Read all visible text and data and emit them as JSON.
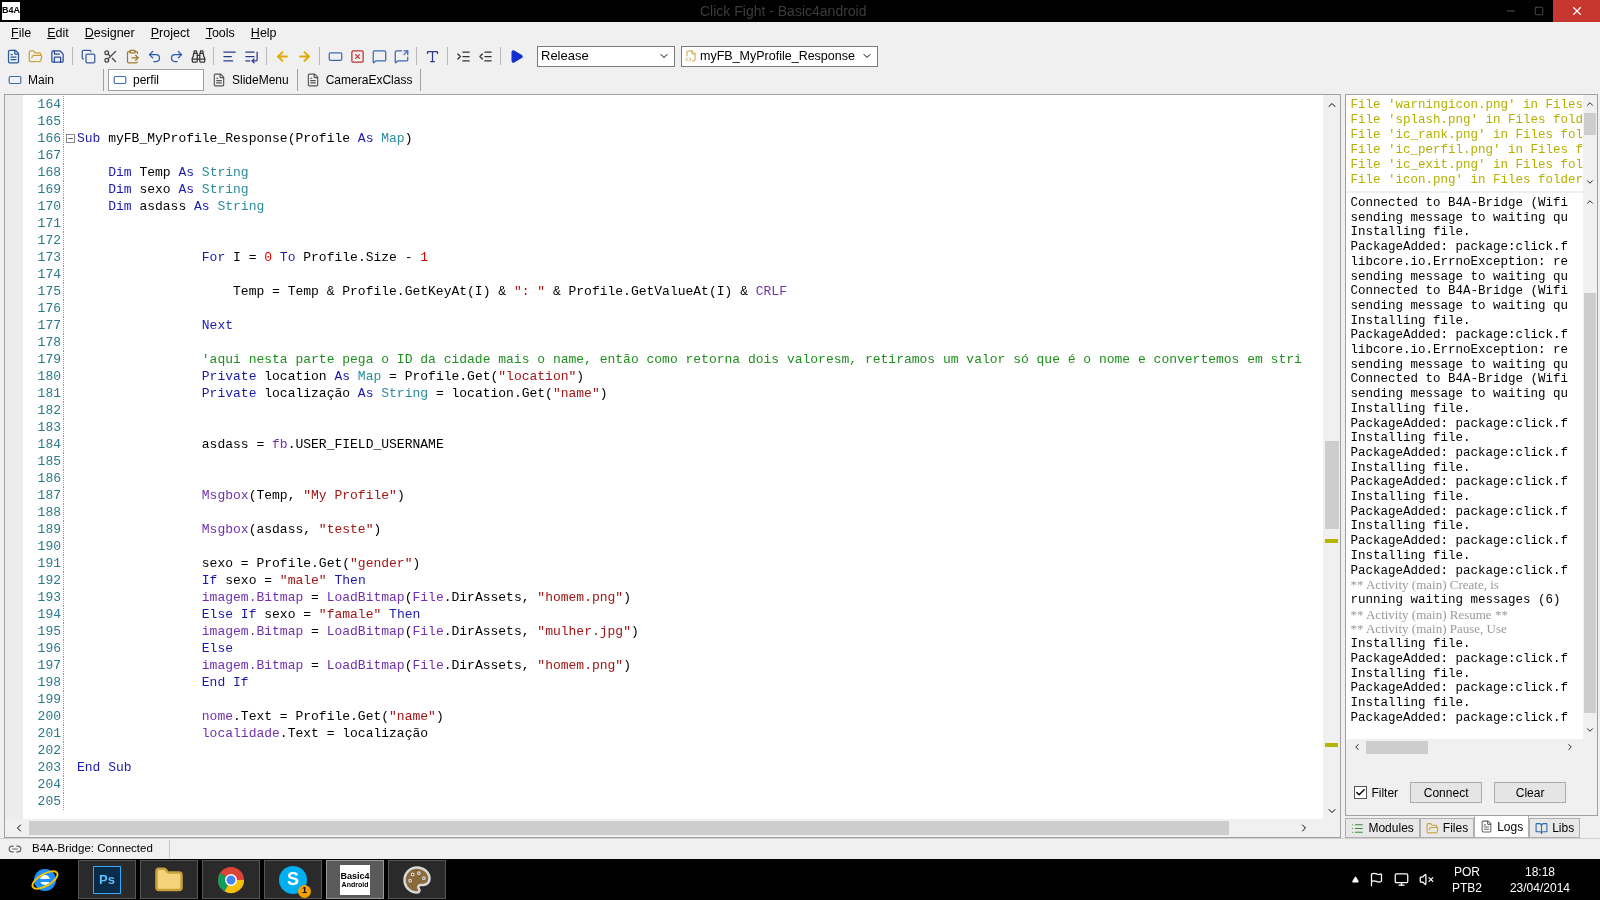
{
  "window": {
    "logo": "B4A",
    "title": "Click Fight - Basic4android"
  },
  "menu": [
    "File",
    "Edit",
    "Designer",
    "Project",
    "Tools",
    "Help"
  ],
  "toolbar": {
    "build_config": "Release",
    "sub_selector": "myFB_MyProfile_Response"
  },
  "module_tabs": [
    {
      "label": "Main",
      "selected": false
    },
    {
      "label": "perfil",
      "selected": true
    },
    {
      "label": "SlideMenu",
      "selected": false
    },
    {
      "label": "CameraExClass",
      "selected": false
    }
  ],
  "editor": {
    "lines": [
      {
        "number": "164"
      },
      {
        "number": "165"
      },
      {
        "number": "166",
        "fold": true,
        "tokens": [
          {
            "kind": "kw",
            "text": "Sub"
          },
          {
            "kind": "plain",
            "text": " myFB_MyProfile_Response(Profile "
          },
          {
            "kind": "kw",
            "text": "As"
          },
          {
            "kind": "type",
            "text": " Map"
          },
          {
            "kind": "plain",
            "text": ")"
          }
        ]
      },
      {
        "number": "167"
      },
      {
        "number": "168",
        "tokens": [
          {
            "kind": "kw",
            "text": "    Dim"
          },
          {
            "kind": "plain",
            "text": " Temp "
          },
          {
            "kind": "kw",
            "text": "As"
          },
          {
            "kind": "type",
            "text": " String"
          }
        ]
      },
      {
        "number": "169",
        "tokens": [
          {
            "kind": "kw",
            "text": "    Dim"
          },
          {
            "kind": "plain",
            "text": " sexo "
          },
          {
            "kind": "kw",
            "text": "As"
          },
          {
            "kind": "type",
            "text": " String"
          }
        ]
      },
      {
        "number": "170",
        "tokens": [
          {
            "kind": "kw",
            "text": "    Dim"
          },
          {
            "kind": "plain",
            "text": " asdass "
          },
          {
            "kind": "kw",
            "text": "As"
          },
          {
            "kind": "type",
            "text": " String"
          }
        ]
      },
      {
        "number": "171"
      },
      {
        "number": "172"
      },
      {
        "number": "173",
        "tokens": [
          {
            "kind": "kw",
            "text": "                For"
          },
          {
            "kind": "plain",
            "text": " I = "
          },
          {
            "kind": "num",
            "text": "0"
          },
          {
            "kind": "kw",
            "text": " To"
          },
          {
            "kind": "plain",
            "text": " Profile.Size - "
          },
          {
            "kind": "num",
            "text": "1"
          }
        ]
      },
      {
        "number": "174"
      },
      {
        "number": "175",
        "tokens": [
          {
            "kind": "plain",
            "text": "                    Temp = Temp & Profile.GetKeyAt(I) & "
          },
          {
            "kind": "str",
            "text": "\": \""
          },
          {
            "kind": "plain",
            "text": " & Profile.GetValueAt(I) & "
          },
          {
            "kind": "obj",
            "text": "CRLF"
          }
        ]
      },
      {
        "number": "176"
      },
      {
        "number": "177",
        "tokens": [
          {
            "kind": "kw",
            "text": "                Next"
          }
        ]
      },
      {
        "number": "178"
      },
      {
        "number": "179",
        "tokens": [
          {
            "kind": "cmt",
            "text": "                'aqui nesta parte pega o ID da cidade mais o name, então como retorna dois valoresm, retiramos um valor só que é o nome e convertemos em stri"
          }
        ]
      },
      {
        "number": "180",
        "tokens": [
          {
            "kind": "kw",
            "text": "                Private"
          },
          {
            "kind": "plain",
            "text": " location "
          },
          {
            "kind": "kw",
            "text": "As"
          },
          {
            "kind": "type",
            "text": " Map"
          },
          {
            "kind": "plain",
            "text": " = Profile.Get("
          },
          {
            "kind": "str",
            "text": "\"location\""
          },
          {
            "kind": "plain",
            "text": ")"
          }
        ]
      },
      {
        "number": "181",
        "tokens": [
          {
            "kind": "kw",
            "text": "                Private"
          },
          {
            "kind": "plain",
            "text": " localização "
          },
          {
            "kind": "kw",
            "text": "As"
          },
          {
            "kind": "type",
            "text": " String"
          },
          {
            "kind": "plain",
            "text": " = location.Get("
          },
          {
            "kind": "str",
            "text": "\"name\""
          },
          {
            "kind": "plain",
            "text": ")"
          }
        ]
      },
      {
        "number": "182"
      },
      {
        "number": "183"
      },
      {
        "number": "184",
        "tokens": [
          {
            "kind": "plain",
            "text": "                asdass = "
          },
          {
            "kind": "obj",
            "text": "fb"
          },
          {
            "kind": "plain",
            "text": ".USER_FIELD_USERNAME"
          }
        ]
      },
      {
        "number": "185"
      },
      {
        "number": "186"
      },
      {
        "number": "187",
        "tokens": [
          {
            "kind": "obj",
            "text": "                Msgbox"
          },
          {
            "kind": "plain",
            "text": "(Temp, "
          },
          {
            "kind": "str",
            "text": "\"My Profile\""
          },
          {
            "kind": "plain",
            "text": ")"
          }
        ]
      },
      {
        "number": "188"
      },
      {
        "number": "189",
        "tokens": [
          {
            "kind": "obj",
            "text": "                Msgbox"
          },
          {
            "kind": "plain",
            "text": "(asdass, "
          },
          {
            "kind": "str",
            "text": "\"teste\""
          },
          {
            "kind": "plain",
            "text": ")"
          }
        ]
      },
      {
        "number": "190"
      },
      {
        "number": "191",
        "tokens": [
          {
            "kind": "plain",
            "text": "                sexo = Profile.Get("
          },
          {
            "kind": "str",
            "text": "\"gender\""
          },
          {
            "kind": "plain",
            "text": ")"
          }
        ]
      },
      {
        "number": "192",
        "tokens": [
          {
            "kind": "kw",
            "text": "                If"
          },
          {
            "kind": "plain",
            "text": " sexo = "
          },
          {
            "kind": "str",
            "text": "\"male\""
          },
          {
            "kind": "kw",
            "text": " Then"
          }
        ]
      },
      {
        "number": "193",
        "tokens": [
          {
            "kind": "obj",
            "text": "                imagem.Bitmap"
          },
          {
            "kind": "plain",
            "text": " = "
          },
          {
            "kind": "obj",
            "text": "LoadBitmap"
          },
          {
            "kind": "plain",
            "text": "("
          },
          {
            "kind": "obj",
            "text": "File"
          },
          {
            "kind": "plain",
            "text": ".DirAssets, "
          },
          {
            "kind": "str",
            "text": "\"homem.png\""
          },
          {
            "kind": "plain",
            "text": ")"
          }
        ]
      },
      {
        "number": "194",
        "tokens": [
          {
            "kind": "kw",
            "text": "                Else If"
          },
          {
            "kind": "plain",
            "text": " sexo = "
          },
          {
            "kind": "str",
            "text": "\"famale\""
          },
          {
            "kind": "kw",
            "text": " Then"
          }
        ]
      },
      {
        "number": "195",
        "tokens": [
          {
            "kind": "obj",
            "text": "                imagem.Bitmap"
          },
          {
            "kind": "plain",
            "text": " = "
          },
          {
            "kind": "obj",
            "text": "LoadBitmap"
          },
          {
            "kind": "plain",
            "text": "("
          },
          {
            "kind": "obj",
            "text": "File"
          },
          {
            "kind": "plain",
            "text": ".DirAssets, "
          },
          {
            "kind": "str",
            "text": "\"mulher.jpg\""
          },
          {
            "kind": "plain",
            "text": ")"
          }
        ]
      },
      {
        "number": "196",
        "tokens": [
          {
            "kind": "kw",
            "text": "                Else"
          }
        ]
      },
      {
        "number": "197",
        "tokens": [
          {
            "kind": "obj",
            "text": "                imagem.Bitmap"
          },
          {
            "kind": "plain",
            "text": " = "
          },
          {
            "kind": "obj",
            "text": "LoadBitmap"
          },
          {
            "kind": "plain",
            "text": "("
          },
          {
            "kind": "obj",
            "text": "File"
          },
          {
            "kind": "plain",
            "text": ".DirAssets, "
          },
          {
            "kind": "str",
            "text": "\"homem.png\""
          },
          {
            "kind": "plain",
            "text": ")"
          }
        ]
      },
      {
        "number": "198",
        "tokens": [
          {
            "kind": "kw",
            "text": "                End If"
          }
        ]
      },
      {
        "number": "199"
      },
      {
        "number": "200",
        "tokens": [
          {
            "kind": "obj",
            "text": "                nome"
          },
          {
            "kind": "plain",
            "text": ".Text = Profile.Get("
          },
          {
            "kind": "str",
            "text": "\"name\""
          },
          {
            "kind": "plain",
            "text": ")"
          }
        ]
      },
      {
        "number": "201",
        "tokens": [
          {
            "kind": "obj",
            "text": "                localidade"
          },
          {
            "kind": "plain",
            "text": ".Text = localização"
          }
        ]
      },
      {
        "number": "202"
      },
      {
        "number": "203",
        "tokens": [
          {
            "kind": "kw",
            "text": "End Sub"
          }
        ]
      },
      {
        "number": "204"
      },
      {
        "number": "205"
      }
    ]
  },
  "right_panel": {
    "file_warnings": [
      "File 'warningicon.png' in Files",
      "File 'splash.png' in Files fold",
      "File 'ic_rank.png' in Files fol",
      "File 'ic_perfil.png' in Files f",
      "File 'ic_exit.png' in Files fol",
      "File 'icon.png' in Files folder"
    ],
    "logs": [
      {
        "kind": "normal",
        "text": "Connected to B4A-Bridge (Wifi"
      },
      {
        "kind": "normal",
        "text": "sending message to waiting qu"
      },
      {
        "kind": "normal",
        "text": "Installing file."
      },
      {
        "kind": "normal",
        "text": "PackageAdded: package:click.f"
      },
      {
        "kind": "normal",
        "text": "libcore.io.ErrnoException: re"
      },
      {
        "kind": "normal",
        "text": "sending message to waiting qu"
      },
      {
        "kind": "normal",
        "text": "Connected to B4A-Bridge (Wifi"
      },
      {
        "kind": "normal",
        "text": "sending message to waiting qu"
      },
      {
        "kind": "normal",
        "text": "Installing file."
      },
      {
        "kind": "normal",
        "text": "PackageAdded: package:click.f"
      },
      {
        "kind": "normal",
        "text": "libcore.io.ErrnoException: re"
      },
      {
        "kind": "normal",
        "text": "sending message to waiting qu"
      },
      {
        "kind": "normal",
        "text": "Connected to B4A-Bridge (Wifi"
      },
      {
        "kind": "normal",
        "text": "sending message to waiting qu"
      },
      {
        "kind": "normal",
        "text": "Installing file."
      },
      {
        "kind": "normal",
        "text": "PackageAdded: package:click.f"
      },
      {
        "kind": "normal",
        "text": "Installing file."
      },
      {
        "kind": "normal",
        "text": "PackageAdded: package:click.f"
      },
      {
        "kind": "normal",
        "text": "Installing file."
      },
      {
        "kind": "normal",
        "text": "PackageAdded: package:click.f"
      },
      {
        "kind": "normal",
        "text": "Installing file."
      },
      {
        "kind": "normal",
        "text": "PackageAdded: package:click.f"
      },
      {
        "kind": "normal",
        "text": "Installing file."
      },
      {
        "kind": "normal",
        "text": "PackageAdded: package:click.f"
      },
      {
        "kind": "normal",
        "text": "Installing file."
      },
      {
        "kind": "normal",
        "text": "PackageAdded: package:click.f"
      },
      {
        "kind": "activity",
        "text": "** Activity (main) Create, is"
      },
      {
        "kind": "normal",
        "text": "running waiting messages (6)"
      },
      {
        "kind": "activity",
        "text": "** Activity (main) Resume **"
      },
      {
        "kind": "activity",
        "text": "** Activity (main) Pause, Use"
      },
      {
        "kind": "normal",
        "text": "Installing file."
      },
      {
        "kind": "normal",
        "text": "PackageAdded: package:click.f"
      },
      {
        "kind": "normal",
        "text": "Installing file."
      },
      {
        "kind": "normal",
        "text": "PackageAdded: package:click.f"
      },
      {
        "kind": "normal",
        "text": "Installing file."
      },
      {
        "kind": "normal",
        "text": "PackageAdded: package:click.f"
      }
    ],
    "filter": {
      "label": "Filter",
      "checked": true
    },
    "buttons": [
      "Connect",
      "Clear"
    ],
    "tabs": [
      {
        "kind": "modules",
        "label": "Modules",
        "selected": false
      },
      {
        "kind": "files",
        "label": "Files",
        "selected": false
      },
      {
        "kind": "logs",
        "label": "Logs",
        "selected": true
      },
      {
        "kind": "libs",
        "label": "Libs",
        "selected": false
      }
    ]
  },
  "status_bar": {
    "text": "B4A-Bridge: Connected"
  },
  "taskbar": {
    "apps": [
      {
        "kind": "ie",
        "selected": false
      },
      {
        "kind": "ps",
        "label": "Ps",
        "selected": false
      },
      {
        "kind": "folder",
        "selected": false
      },
      {
        "kind": "chrome",
        "selected": false
      },
      {
        "kind": "skype",
        "label": "S",
        "badge": "1",
        "selected": false
      },
      {
        "kind": "b4a",
        "label": "Basic4",
        "sublabel": "Android",
        "selected": true
      },
      {
        "kind": "paint",
        "selected": false
      }
    ],
    "tray": {
      "language": "POR",
      "layout": "PTB2",
      "time": "18:18",
      "date": "23/04/2014"
    }
  }
}
